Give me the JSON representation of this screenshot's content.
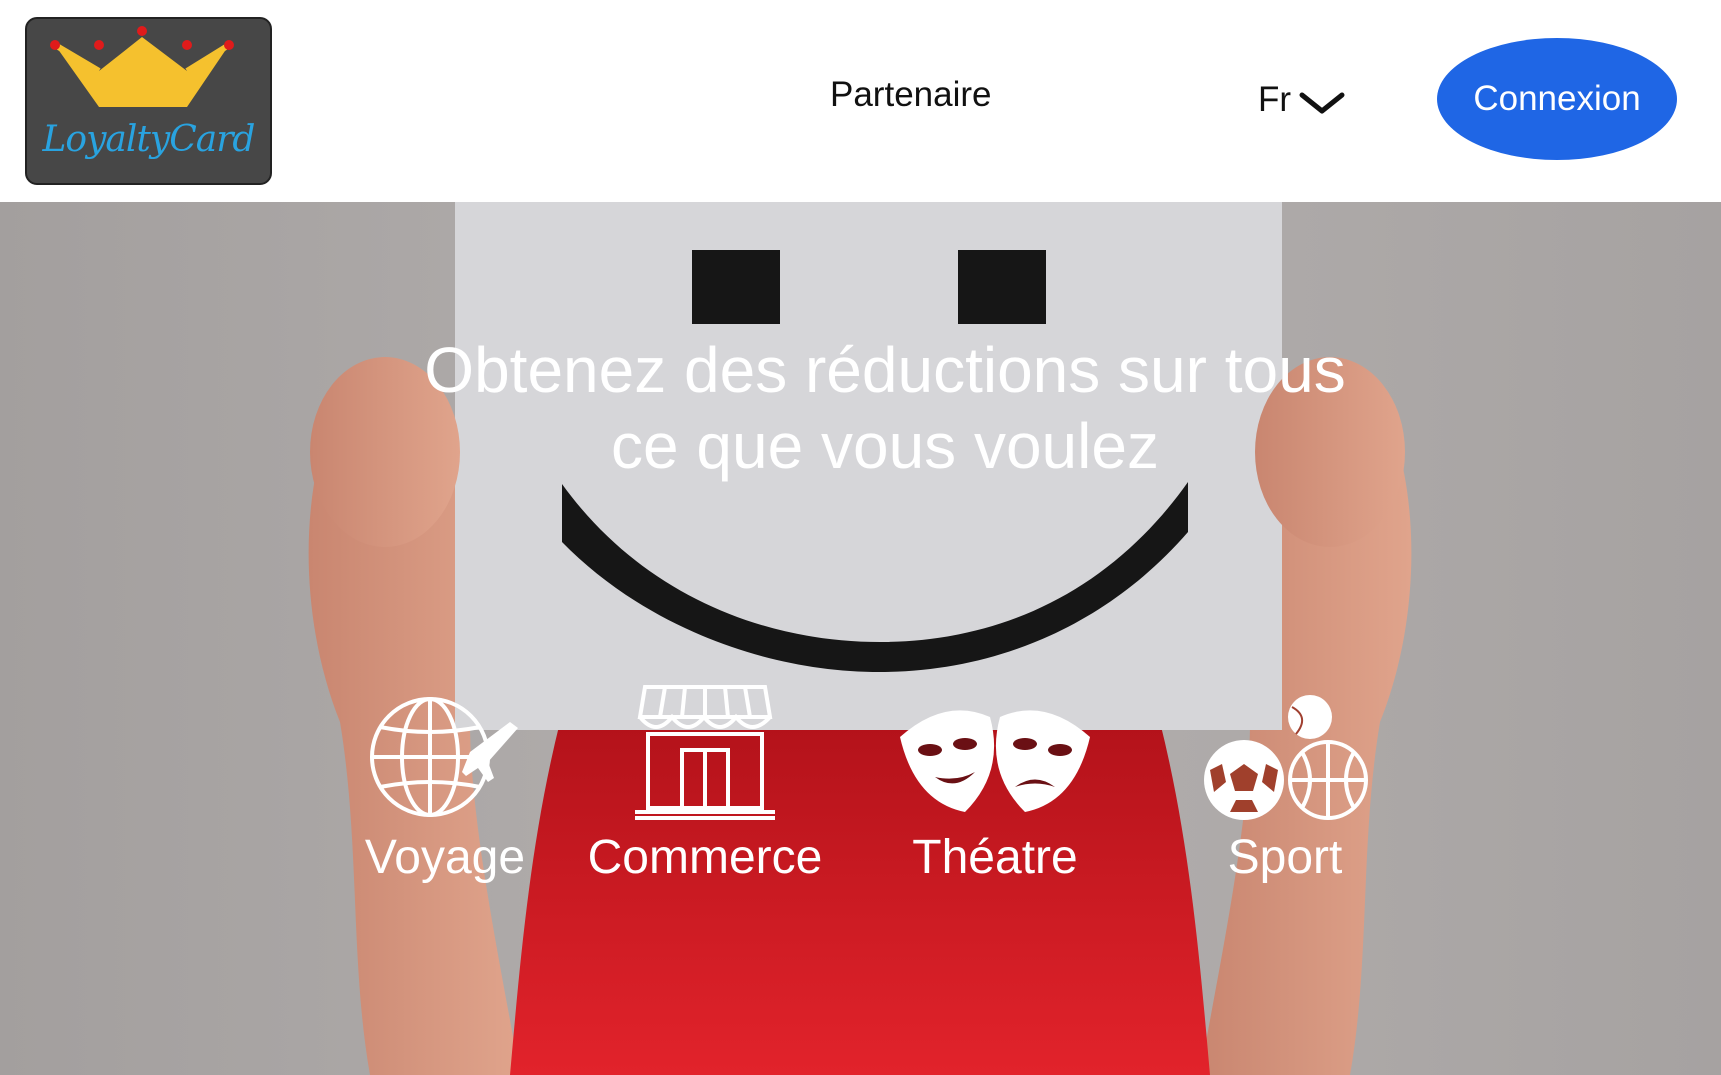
{
  "header": {
    "logo": {
      "text": "LoyaltyCard",
      "icon": "crown-icon"
    },
    "nav": {
      "partner_label": "Partenaire"
    },
    "language": {
      "selected": "Fr",
      "icon": "chevron-down-icon"
    },
    "login_label": "Connexion"
  },
  "hero": {
    "headline_line1": "Obtenez des réductions sur tous",
    "headline_line2": "ce que vous voulez",
    "categories": [
      {
        "label": "Voyage",
        "icon": "globe-plane-icon"
      },
      {
        "label": "Commerce",
        "icon": "storefront-icon"
      },
      {
        "label": "Théatre",
        "icon": "theatre-masks-icon"
      },
      {
        "label": "Sport",
        "icon": "sport-balls-icon"
      }
    ]
  },
  "colors": {
    "login_button": "#1f66e5",
    "logo_background": "#474747",
    "logo_text": "#29a3e0",
    "crown": "#f5c12e"
  }
}
